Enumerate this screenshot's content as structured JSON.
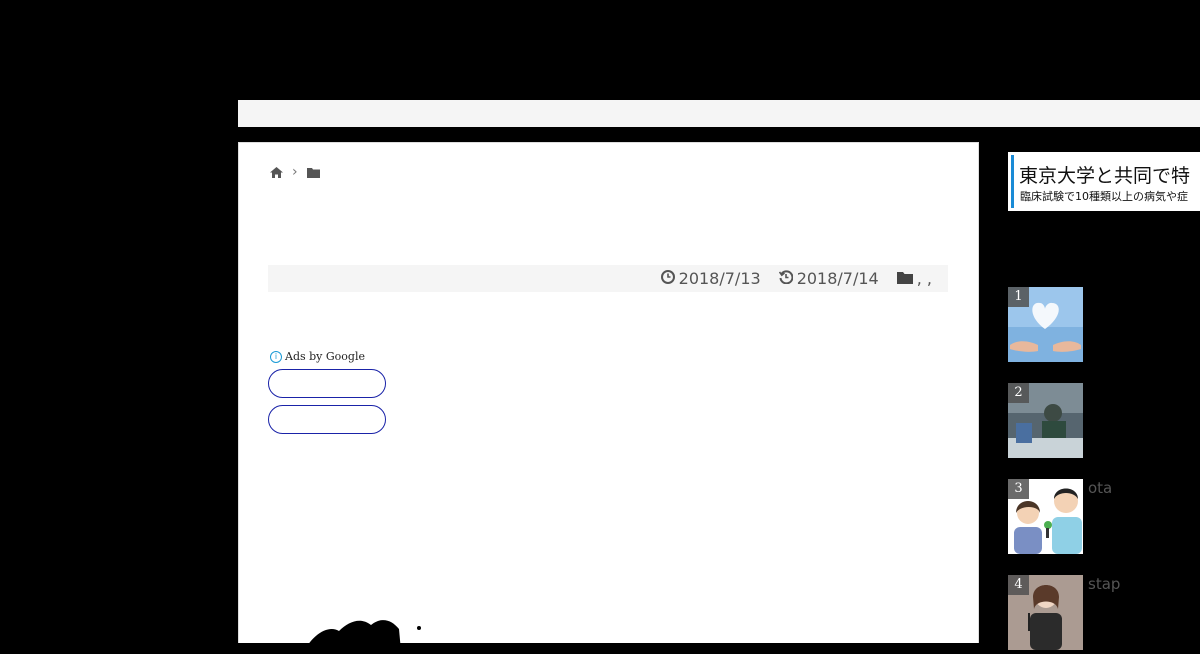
{
  "breadcrumb": {
    "home_icon": "home-icon",
    "separator": "›",
    "folder_icon": "folder-icon"
  },
  "meta": {
    "published": "2018/7/13",
    "updated": "2018/7/14",
    "categories": ", ,"
  },
  "ads": {
    "label": "Ads by Google",
    "info": "i"
  },
  "banner": {
    "headline": "東京大学と共同で特",
    "subtext": "臨床試験で10種類以上の病気や症"
  },
  "ranking": [
    {
      "rank": "1",
      "title": ""
    },
    {
      "rank": "2",
      "title": ""
    },
    {
      "rank": "3",
      "title": "ota"
    },
    {
      "rank": "4",
      "title": "stap"
    }
  ],
  "colors": {
    "page_bg": "#000000",
    "accent": "#1a8bd6",
    "ad_outline": "#1a23a8"
  }
}
